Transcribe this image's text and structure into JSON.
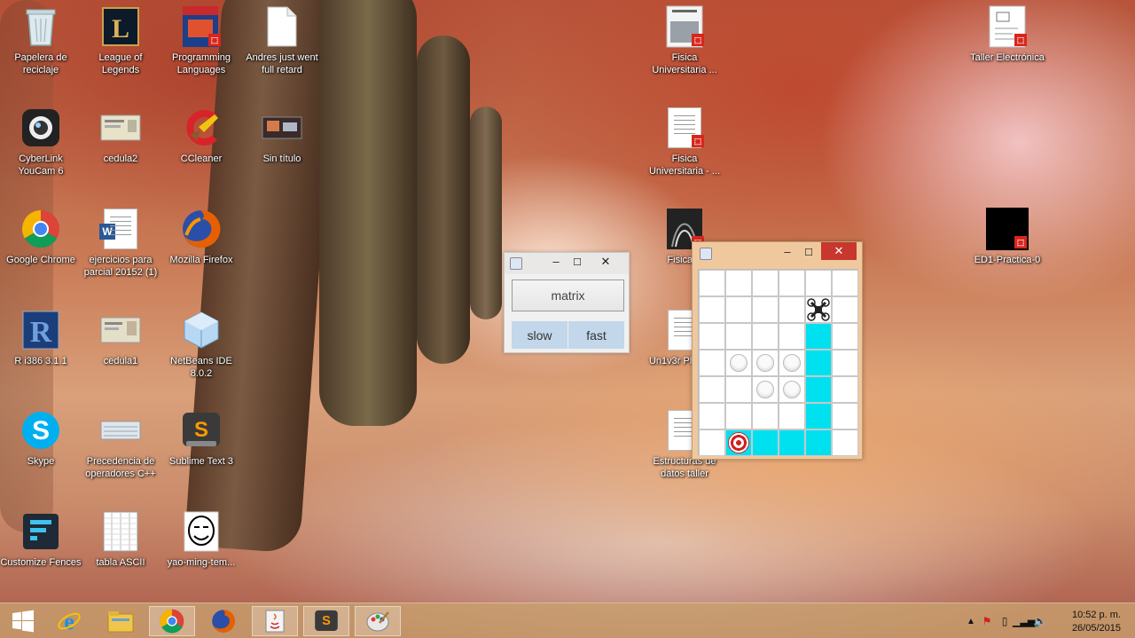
{
  "desktop": {
    "icons": [
      {
        "label": "Papelera de reciclaje",
        "icon": "recycle-bin-icon"
      },
      {
        "label": "League of Legends",
        "icon": "league-of-legends-icon"
      },
      {
        "label": "Programming Languages",
        "icon": "pdf-book-icon"
      },
      {
        "label": "Andres just went full retard",
        "icon": "blank-file-icon"
      },
      {
        "label": "Fisica Universitaria ...",
        "icon": "pdf-book-icon"
      },
      {
        "label": "Taller Electrónica",
        "icon": "pdf-doc-icon"
      },
      {
        "label": "CyberLink YouCam 6",
        "icon": "webcam-icon"
      },
      {
        "label": "cedula2",
        "icon": "id-card-image-icon"
      },
      {
        "label": "CCleaner",
        "icon": "ccleaner-icon"
      },
      {
        "label": "Sin título",
        "icon": "image-thumbnail-icon"
      },
      {
        "label": "Fisica Universitaria - ...",
        "icon": "pdf-doc-icon"
      },
      {
        "label": "Google Chrome",
        "icon": "chrome-icon"
      },
      {
        "label": "ejercicios para parcial 20152 (1)",
        "icon": "word-doc-icon"
      },
      {
        "label": "Mozilla Firefox",
        "icon": "firefox-icon"
      },
      {
        "label": "Fisica B",
        "icon": "pdf-doc-icon"
      },
      {
        "label": "ED1-Practica-0",
        "icon": "pdf-black-icon"
      },
      {
        "label": "R i386 3.1.1",
        "icon": "r-language-icon"
      },
      {
        "label": "cedula1",
        "icon": "id-card-image-icon"
      },
      {
        "label": "NetBeans IDE 8.0.2",
        "icon": "netbeans-icon"
      },
      {
        "label": "Un1v3r Phys1cs",
        "icon": "pdf-doc-icon"
      },
      {
        "label": "Skype",
        "icon": "skype-icon"
      },
      {
        "label": "Precedencia de operadores C++",
        "icon": "image-thumbnail-icon"
      },
      {
        "label": "Sublime Text 3",
        "icon": "sublime-text-icon"
      },
      {
        "label": "Estructuras de datos taller",
        "icon": "pdf-doc-icon"
      },
      {
        "label": "Customize Fences",
        "icon": "fences-icon"
      },
      {
        "label": "tabla ASCII",
        "icon": "table-image-icon"
      },
      {
        "label": "yao-ming-tem...",
        "icon": "meme-face-icon"
      }
    ]
  },
  "matrix_window": {
    "matrix_label": "matrix",
    "slow_label": "slow",
    "fast_label": "fast",
    "minimize": "–",
    "maximize": "☐",
    "close": "✕"
  },
  "grid_window": {
    "minimize": "–",
    "maximize": "☐",
    "close": "✕",
    "rows": 7,
    "cols": 6,
    "path_color": "#00e1f0",
    "cells": [
      [
        "empty",
        "empty",
        "empty",
        "empty",
        "empty",
        "empty"
      ],
      [
        "empty",
        "empty",
        "empty",
        "empty",
        "drone",
        "empty"
      ],
      [
        "empty",
        "empty",
        "empty",
        "empty",
        "path",
        "empty"
      ],
      [
        "empty",
        "obstacle",
        "obstacle",
        "obstacle",
        "path",
        "empty"
      ],
      [
        "empty",
        "empty",
        "obstacle",
        "obstacle",
        "path",
        "empty"
      ],
      [
        "empty",
        "empty",
        "empty",
        "empty",
        "path",
        "empty"
      ],
      [
        "empty",
        "target",
        "path",
        "path",
        "path",
        "empty"
      ]
    ]
  },
  "taskbar": {
    "apps": [
      {
        "name": "start",
        "icon": "windows-start-icon"
      },
      {
        "name": "internet-explorer",
        "icon": "internet-explorer-icon"
      },
      {
        "name": "file-explorer",
        "icon": "file-explorer-icon"
      },
      {
        "name": "chrome",
        "icon": "chrome-icon"
      },
      {
        "name": "firefox",
        "icon": "firefox-icon"
      },
      {
        "name": "java",
        "icon": "java-icon"
      },
      {
        "name": "sublime",
        "icon": "sublime-text-icon"
      },
      {
        "name": "paint",
        "icon": "paint-icon"
      }
    ],
    "time": "10:52 p. m.",
    "date": "26/05/2015"
  }
}
